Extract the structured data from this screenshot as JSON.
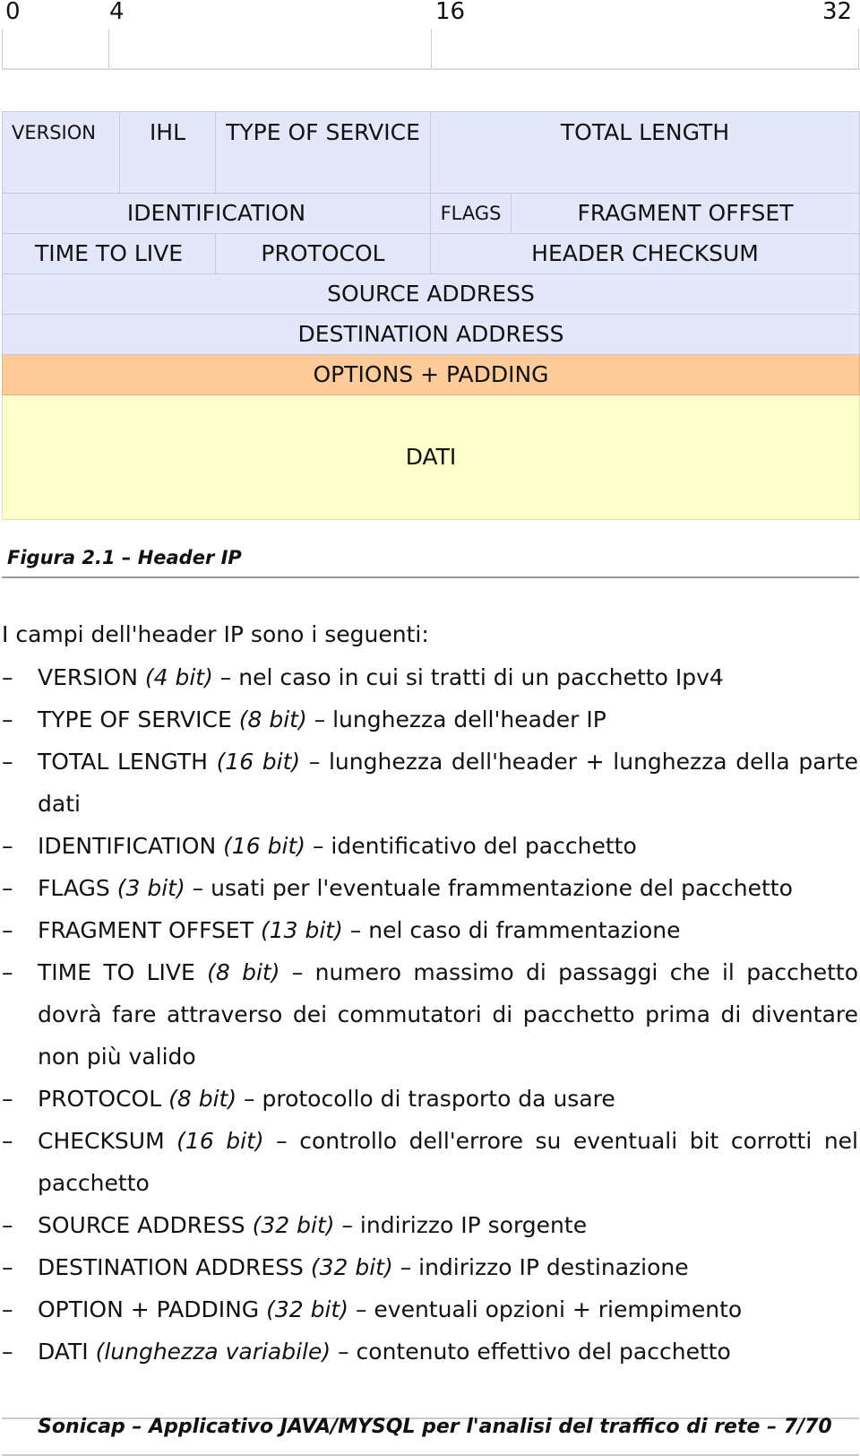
{
  "scale": {
    "ticks": [
      "0",
      "4",
      "16",
      "32"
    ]
  },
  "header_table": {
    "row1": {
      "version": "VERSION",
      "ihl": "IHL",
      "tos": "TYPE OF SERVICE",
      "total_length": "TOTAL LENGTH"
    },
    "row2": {
      "identification": "IDENTIFICATION",
      "flags": "FLAGS",
      "fragment_offset": "FRAGMENT OFFSET"
    },
    "row3": {
      "ttl": "TIME TO LIVE",
      "protocol": "PROTOCOL",
      "checksum": "HEADER CHECKSUM"
    },
    "row4": {
      "source": "SOURCE ADDRESS"
    },
    "row5": {
      "destination": "DESTINATION ADDRESS"
    },
    "row6": {
      "options": "OPTIONS + PADDING"
    },
    "row7": {
      "data": "DATI"
    },
    "colors": {
      "header": "#e4e6fa",
      "options": "#ffcc99",
      "data": "#ffffcc"
    }
  },
  "caption": "Figura 2.1 – Header IP",
  "intro": "I campi dell'header IP sono i seguenti:",
  "fields": [
    {
      "dash": "–",
      "name": "VERSION",
      "size": "(4 bit)",
      "desc": " – nel caso in cui si tratti di un pacchetto Ipv4"
    },
    {
      "dash": "–",
      "name": "TYPE OF SERVICE",
      "size": "(8 bit)",
      "desc": " – lunghezza dell'header IP"
    },
    {
      "dash": "–",
      "name": "TOTAL LENGTH",
      "size": "(16 bit)",
      "desc": " – lunghezza dell'header + lunghezza della parte dati"
    },
    {
      "dash": "–",
      "name": "IDENTIFICATION",
      "size": "(16 bit)",
      "desc": " – identificativo del pacchetto"
    },
    {
      "dash": "–",
      "name": "FLAGS",
      "size": "(3 bit)",
      "desc": " – usati per l'eventuale frammentazione del pacchetto"
    },
    {
      "dash": "–",
      "name": "FRAGMENT OFFSET",
      "size": "(13 bit)",
      "desc": " – nel caso di frammentazione"
    },
    {
      "dash": "–",
      "name": "TIME TO LIVE",
      "size": "(8 bit)",
      "desc": " – numero massimo di passaggi che il pacchetto dovrà fare attraverso dei commutatori di pacchetto prima di diventare non più valido"
    },
    {
      "dash": "–",
      "name": "PROTOCOL",
      "size": "(8 bit)",
      "desc": " – protocollo di trasporto da usare"
    },
    {
      "dash": "–",
      "name": "CHECKSUM",
      "size": "(16 bit)",
      "desc": " – controllo dell'errore su eventuali bit corrotti nel pacchetto"
    },
    {
      "dash": "–",
      "name": "SOURCE ADDRESS",
      "size": "(32 bit)",
      "desc": " – indirizzo IP sorgente"
    },
    {
      "dash": "–",
      "name": "DESTINATION ADDRESS",
      "size": "(32 bit)",
      "desc": " – indirizzo IP destinazione"
    },
    {
      "dash": "–",
      "name": "OPTION + PADDING",
      "size": "(32 bit)",
      "desc": " – eventuali opzioni + riempimento"
    },
    {
      "dash": "–",
      "name": "DATI",
      "size": "(lunghezza variabile)",
      "desc": " – contenuto effettivo del pacchetto"
    }
  ],
  "footer": "Sonicap – Applicativo JAVA/MYSQL per l'analisi del traffico di rete – 7/70"
}
